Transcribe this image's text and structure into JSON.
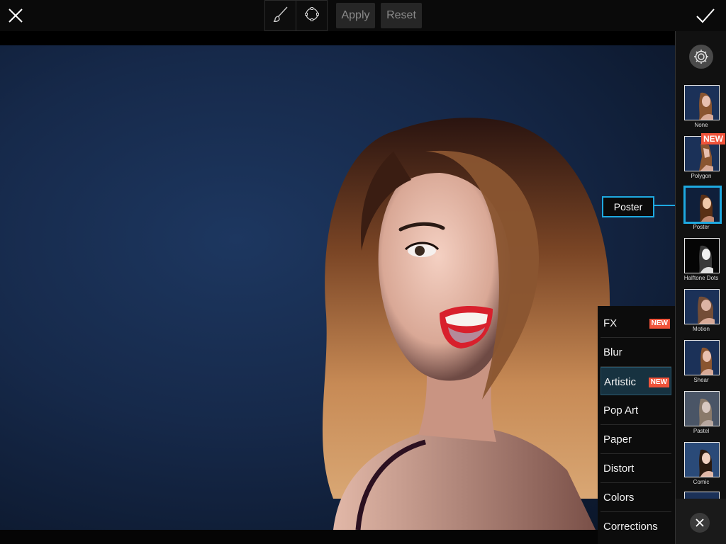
{
  "toolbar": {
    "close_icon": "close-icon",
    "brush_icon": "brush-icon",
    "lasso_icon": "lasso-icon",
    "apply_label": "Apply",
    "reset_label": "Reset",
    "confirm_icon": "checkmark-icon"
  },
  "effects_panel": {
    "settings_icon": "gear-icon",
    "selected": "Poster",
    "tooltip": "Poster",
    "items": [
      {
        "label": "None",
        "new": false
      },
      {
        "label": "Polygon",
        "new": true,
        "badge": "NEW"
      },
      {
        "label": "Poster",
        "new": false,
        "selected": true
      },
      {
        "label": "Halftone Dots",
        "new": false
      },
      {
        "label": "Motion",
        "new": false
      },
      {
        "label": "Shear",
        "new": false
      },
      {
        "label": "Pastel",
        "new": false
      },
      {
        "label": "Comic",
        "new": false
      }
    ],
    "close_icon": "close-icon"
  },
  "categories": {
    "active": "Artistic",
    "items": [
      {
        "label": "FX",
        "badge": "NEW"
      },
      {
        "label": "Blur",
        "badge": ""
      },
      {
        "label": "Artistic",
        "badge": "NEW"
      },
      {
        "label": "Pop Art",
        "badge": ""
      },
      {
        "label": "Paper",
        "badge": ""
      },
      {
        "label": "Distort",
        "badge": ""
      },
      {
        "label": "Colors",
        "badge": ""
      },
      {
        "label": "Corrections",
        "badge": ""
      }
    ]
  },
  "colors": {
    "accent": "#1ea9e0",
    "new_badge": "#f0533a",
    "background": "#0a0a0a"
  }
}
